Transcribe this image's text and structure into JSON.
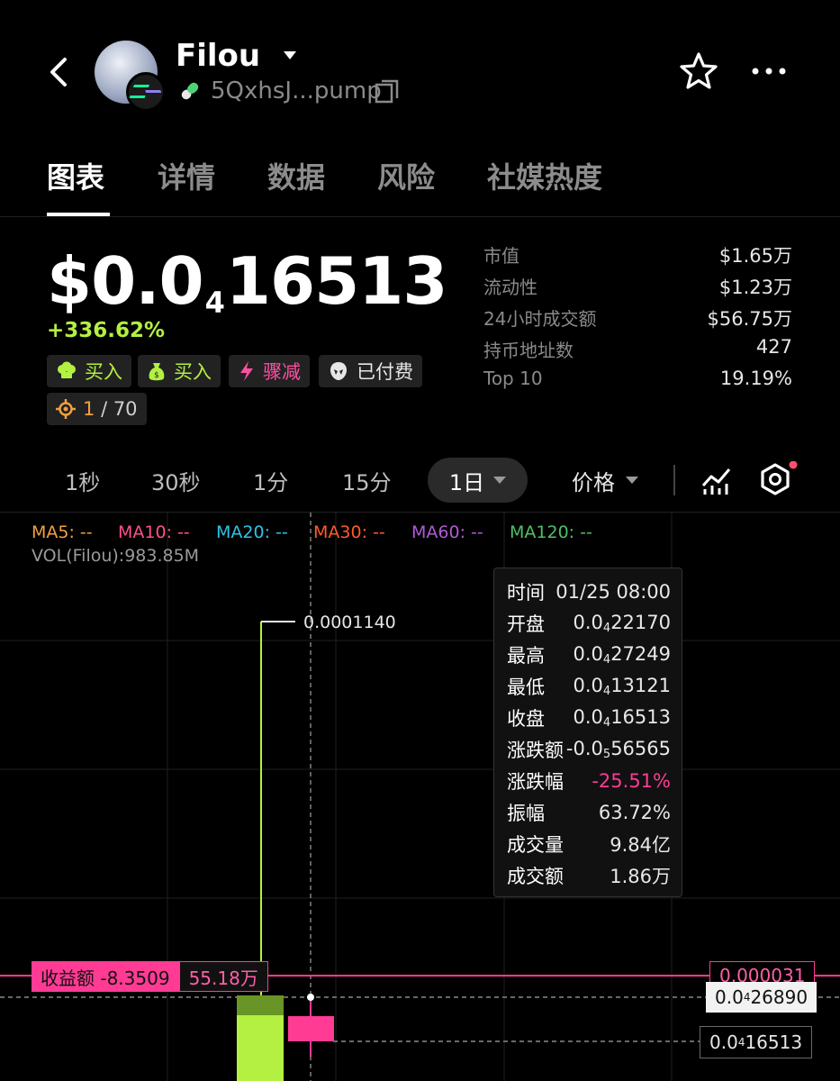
{
  "header": {
    "token_name": "Filou",
    "address": "5QxhsJ...pump",
    "icons": [
      "back-arrow-icon",
      "pill-icon",
      "copy-icon",
      "star-icon",
      "more-icon"
    ]
  },
  "tabs": [
    "图表",
    "详情",
    "数据",
    "风险",
    "社媒热度"
  ],
  "price": {
    "prefix": "$0.0",
    "sub": "4",
    "rest": "16513",
    "change": "+336.62%"
  },
  "tags": [
    {
      "label": "买入",
      "icon": "chef-hat-icon",
      "color": "#b3f041"
    },
    {
      "label": "买入",
      "icon": "money-bag-icon",
      "color": "#b3f041"
    },
    {
      "label": "骤减",
      "icon": "lightning-icon",
      "color": "#ff4fa3"
    },
    {
      "label": "已付费",
      "icon": "eagle-icon",
      "color": "#e6e6e6"
    }
  ],
  "rank_tag": {
    "current": "1",
    "total": "/ 70"
  },
  "stats": [
    {
      "label": "市值",
      "value": "$1.65万"
    },
    {
      "label": "流动性",
      "value": "$1.23万"
    },
    {
      "label": "24小时成交额",
      "value": "$56.75万"
    },
    {
      "label": "持币地址数",
      "value": "427"
    },
    {
      "label": "Top 10",
      "value": "19.19%"
    }
  ],
  "timeframes": {
    "options": [
      "1秒",
      "30秒",
      "1分",
      "15分"
    ],
    "active": "1日",
    "metric": "价格"
  },
  "ma_legend": [
    {
      "label": "MA5: --",
      "color": "#f0a040"
    },
    {
      "label": "MA10: --",
      "color": "#ff4f8b"
    },
    {
      "label": "MA20: --",
      "color": "#2ec4e6"
    },
    {
      "label": "MA30: --",
      "color": "#ff5a2c"
    },
    {
      "label": "MA60: --",
      "color": "#b05ad6"
    },
    {
      "label": "MA120: --",
      "color": "#4fbf6a"
    }
  ],
  "vol_label": "VOL(Filou):983.85M",
  "high_label": "0.0001140",
  "tooltip": {
    "time": {
      "label": "时间",
      "value": "01/25 08:00"
    },
    "rows": [
      {
        "label": "开盘",
        "pre": "0.0",
        "sub": "4",
        "post": "22170"
      },
      {
        "label": "最高",
        "pre": "0.0",
        "sub": "4",
        "post": "27249"
      },
      {
        "label": "最低",
        "pre": "0.0",
        "sub": "4",
        "post": "13121"
      },
      {
        "label": "收盘",
        "pre": "0.0",
        "sub": "4",
        "post": "16513"
      },
      {
        "label": "涨跌额",
        "pre": "-0.0",
        "sub": "5",
        "post": "56565"
      }
    ],
    "change_pct": {
      "label": "涨跌幅",
      "value": "-25.51%"
    },
    "amplitude": {
      "label": "振幅",
      "value": "63.72%"
    },
    "volume": {
      "label": "成交量",
      "value": "9.84亿"
    },
    "turnover": {
      "label": "成交额",
      "value": "1.86万"
    }
  },
  "pnl": {
    "label": "收益额 -8.3509",
    "amount": "55.18万",
    "line_price": "0.000031"
  },
  "crosshair_price": {
    "pre": "0.0",
    "sub": "4",
    "post": "26890"
  },
  "last_price": {
    "pre": "0.0",
    "sub": "4",
    "post": "16513"
  },
  "colors": {
    "up": "#b3f041",
    "down": "#ff3b94",
    "background": "#000000"
  }
}
